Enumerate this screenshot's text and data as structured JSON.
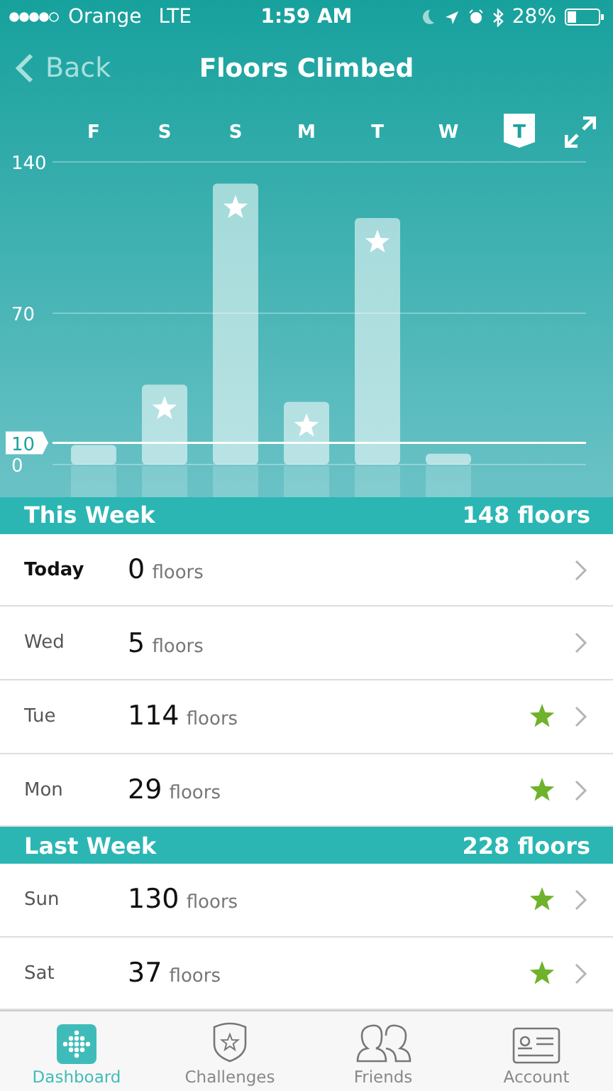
{
  "status_bar": {
    "carrier": "Orange",
    "network": "LTE",
    "time": "1:59 AM",
    "battery": "28%"
  },
  "nav": {
    "back": "Back",
    "title": "Floors Climbed"
  },
  "days": [
    {
      "label": "F",
      "selected": false
    },
    {
      "label": "S",
      "selected": false
    },
    {
      "label": "S",
      "selected": false
    },
    {
      "label": "M",
      "selected": false
    },
    {
      "label": "T",
      "selected": false
    },
    {
      "label": "W",
      "selected": false
    },
    {
      "label": "T",
      "selected": true
    }
  ],
  "chart_data": {
    "type": "bar",
    "values": [
      9,
      37,
      130,
      29,
      114,
      5,
      0
    ],
    "ylim": [
      0,
      140
    ],
    "yticks": [
      0,
      70,
      140
    ],
    "ref_lines": [
      {
        "axis": "y",
        "value": 10,
        "label": "10"
      }
    ]
  },
  "sections": [
    {
      "title": "This Week",
      "total": "148 floors",
      "rows": [
        {
          "day": "Today",
          "value": "0",
          "unit": "floors",
          "current": true,
          "star": false
        },
        {
          "day": "Wed",
          "value": "5",
          "unit": "floors",
          "current": false,
          "star": false
        },
        {
          "day": "Tue",
          "value": "114",
          "unit": "floors",
          "current": false,
          "star": true
        },
        {
          "day": "Mon",
          "value": "29",
          "unit": "floors",
          "current": false,
          "star": true
        }
      ]
    },
    {
      "title": "Last Week",
      "total": "228 floors",
      "rows": [
        {
          "day": "Sun",
          "value": "130",
          "unit": "floors",
          "current": false,
          "star": true
        },
        {
          "day": "Sat",
          "value": "37",
          "unit": "floors",
          "current": false,
          "star": true
        }
      ]
    }
  ],
  "tabs": [
    {
      "label": "Dashboard",
      "selected": true
    },
    {
      "label": "Challenges",
      "selected": false
    },
    {
      "label": "Friends",
      "selected": false
    },
    {
      "label": "Account",
      "selected": false
    }
  ]
}
